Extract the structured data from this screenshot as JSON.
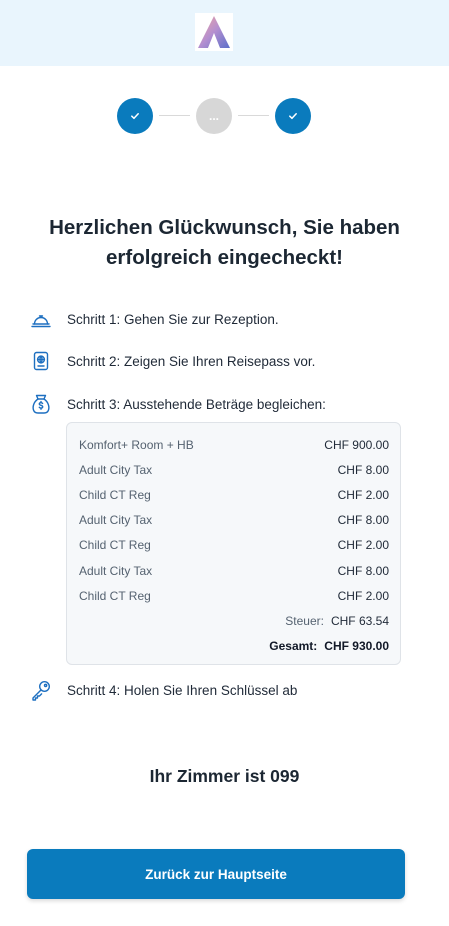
{
  "header": {
    "logo_icon": "brand-a-logo-icon"
  },
  "stepper": {
    "steps": [
      {
        "state": "done",
        "icon": "check-icon"
      },
      {
        "state": "pending",
        "label": "..."
      },
      {
        "state": "done",
        "icon": "check-icon"
      }
    ]
  },
  "headline": {
    "line1": "Herzlichen Glückwunsch, Sie haben",
    "line2": "erfolgreich eingecheckt!"
  },
  "steps": {
    "step1": {
      "icon": "reception-bell-icon",
      "text": "Schritt 1: Gehen Sie zur Rezeption."
    },
    "step2": {
      "icon": "passport-icon",
      "text": "Schritt 2: Zeigen Sie Ihren Reisepass vor."
    },
    "step3": {
      "icon": "money-bag-icon",
      "text": "Schritt 3: Ausstehende Beträge begleichen:"
    },
    "step4": {
      "icon": "key-icon",
      "text": "Schritt 4: Holen Sie Ihren Schlüssel ab"
    }
  },
  "costs": {
    "items": [
      {
        "label": "Komfort+ Room + HB",
        "amount": "CHF 900.00"
      },
      {
        "label": "Adult City Tax",
        "amount": "CHF 8.00"
      },
      {
        "label": "Child CT Reg",
        "amount": "CHF 2.00"
      },
      {
        "label": "Adult City Tax",
        "amount": "CHF 8.00"
      },
      {
        "label": "Child CT Reg",
        "amount": "CHF 2.00"
      },
      {
        "label": "Adult City Tax",
        "amount": "CHF 8.00"
      },
      {
        "label": "Child CT Reg",
        "amount": "CHF 2.00"
      }
    ],
    "tax_label": "Steuer:",
    "tax_value": "CHF 63.54",
    "total_label": "Gesamt:",
    "total_value": "CHF 930.00"
  },
  "room": {
    "text": "Ihr Zimmer ist 099"
  },
  "back_button": {
    "label": "Zurück zur Hauptseite"
  },
  "colors": {
    "primary": "#0a7bbd",
    "header_bg": "#e9f5fd",
    "pending_step": "#d7d7d7"
  }
}
